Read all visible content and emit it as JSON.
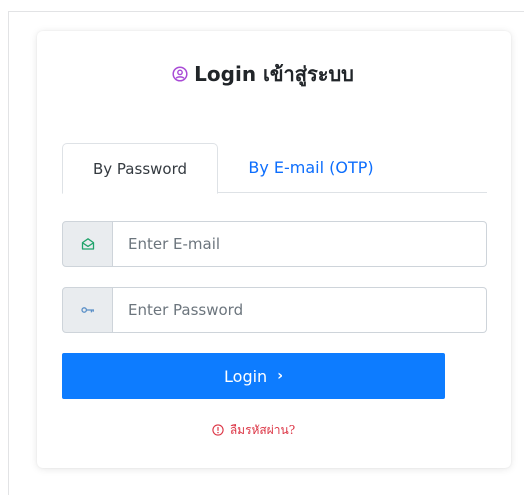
{
  "colors": {
    "accent": "#0d7cff",
    "link": "#0d6efd",
    "danger": "#dc3545",
    "title_icon": "#a94bd6",
    "email_icon": "#20a36b",
    "key_icon": "#5a8fc7"
  },
  "login_card": {
    "title": "Login เข้าสู่ระบบ",
    "title_icon": "user-circle-icon"
  },
  "tabs": [
    {
      "label": "By Password",
      "active": true
    },
    {
      "label": "By E-mail (OTP)",
      "active": false
    }
  ],
  "email_field": {
    "icon": "envelope-open-icon",
    "placeholder": "Enter E-mail",
    "value": ""
  },
  "password_field": {
    "icon": "key-icon",
    "placeholder": "Enter Password",
    "value": ""
  },
  "login_button": {
    "label": "Login",
    "icon": "chevron-right-icon",
    "chevron": "›"
  },
  "forgot_password": {
    "label": "ลืมรหัสผ่าน?",
    "icon": "info-circle-icon"
  }
}
